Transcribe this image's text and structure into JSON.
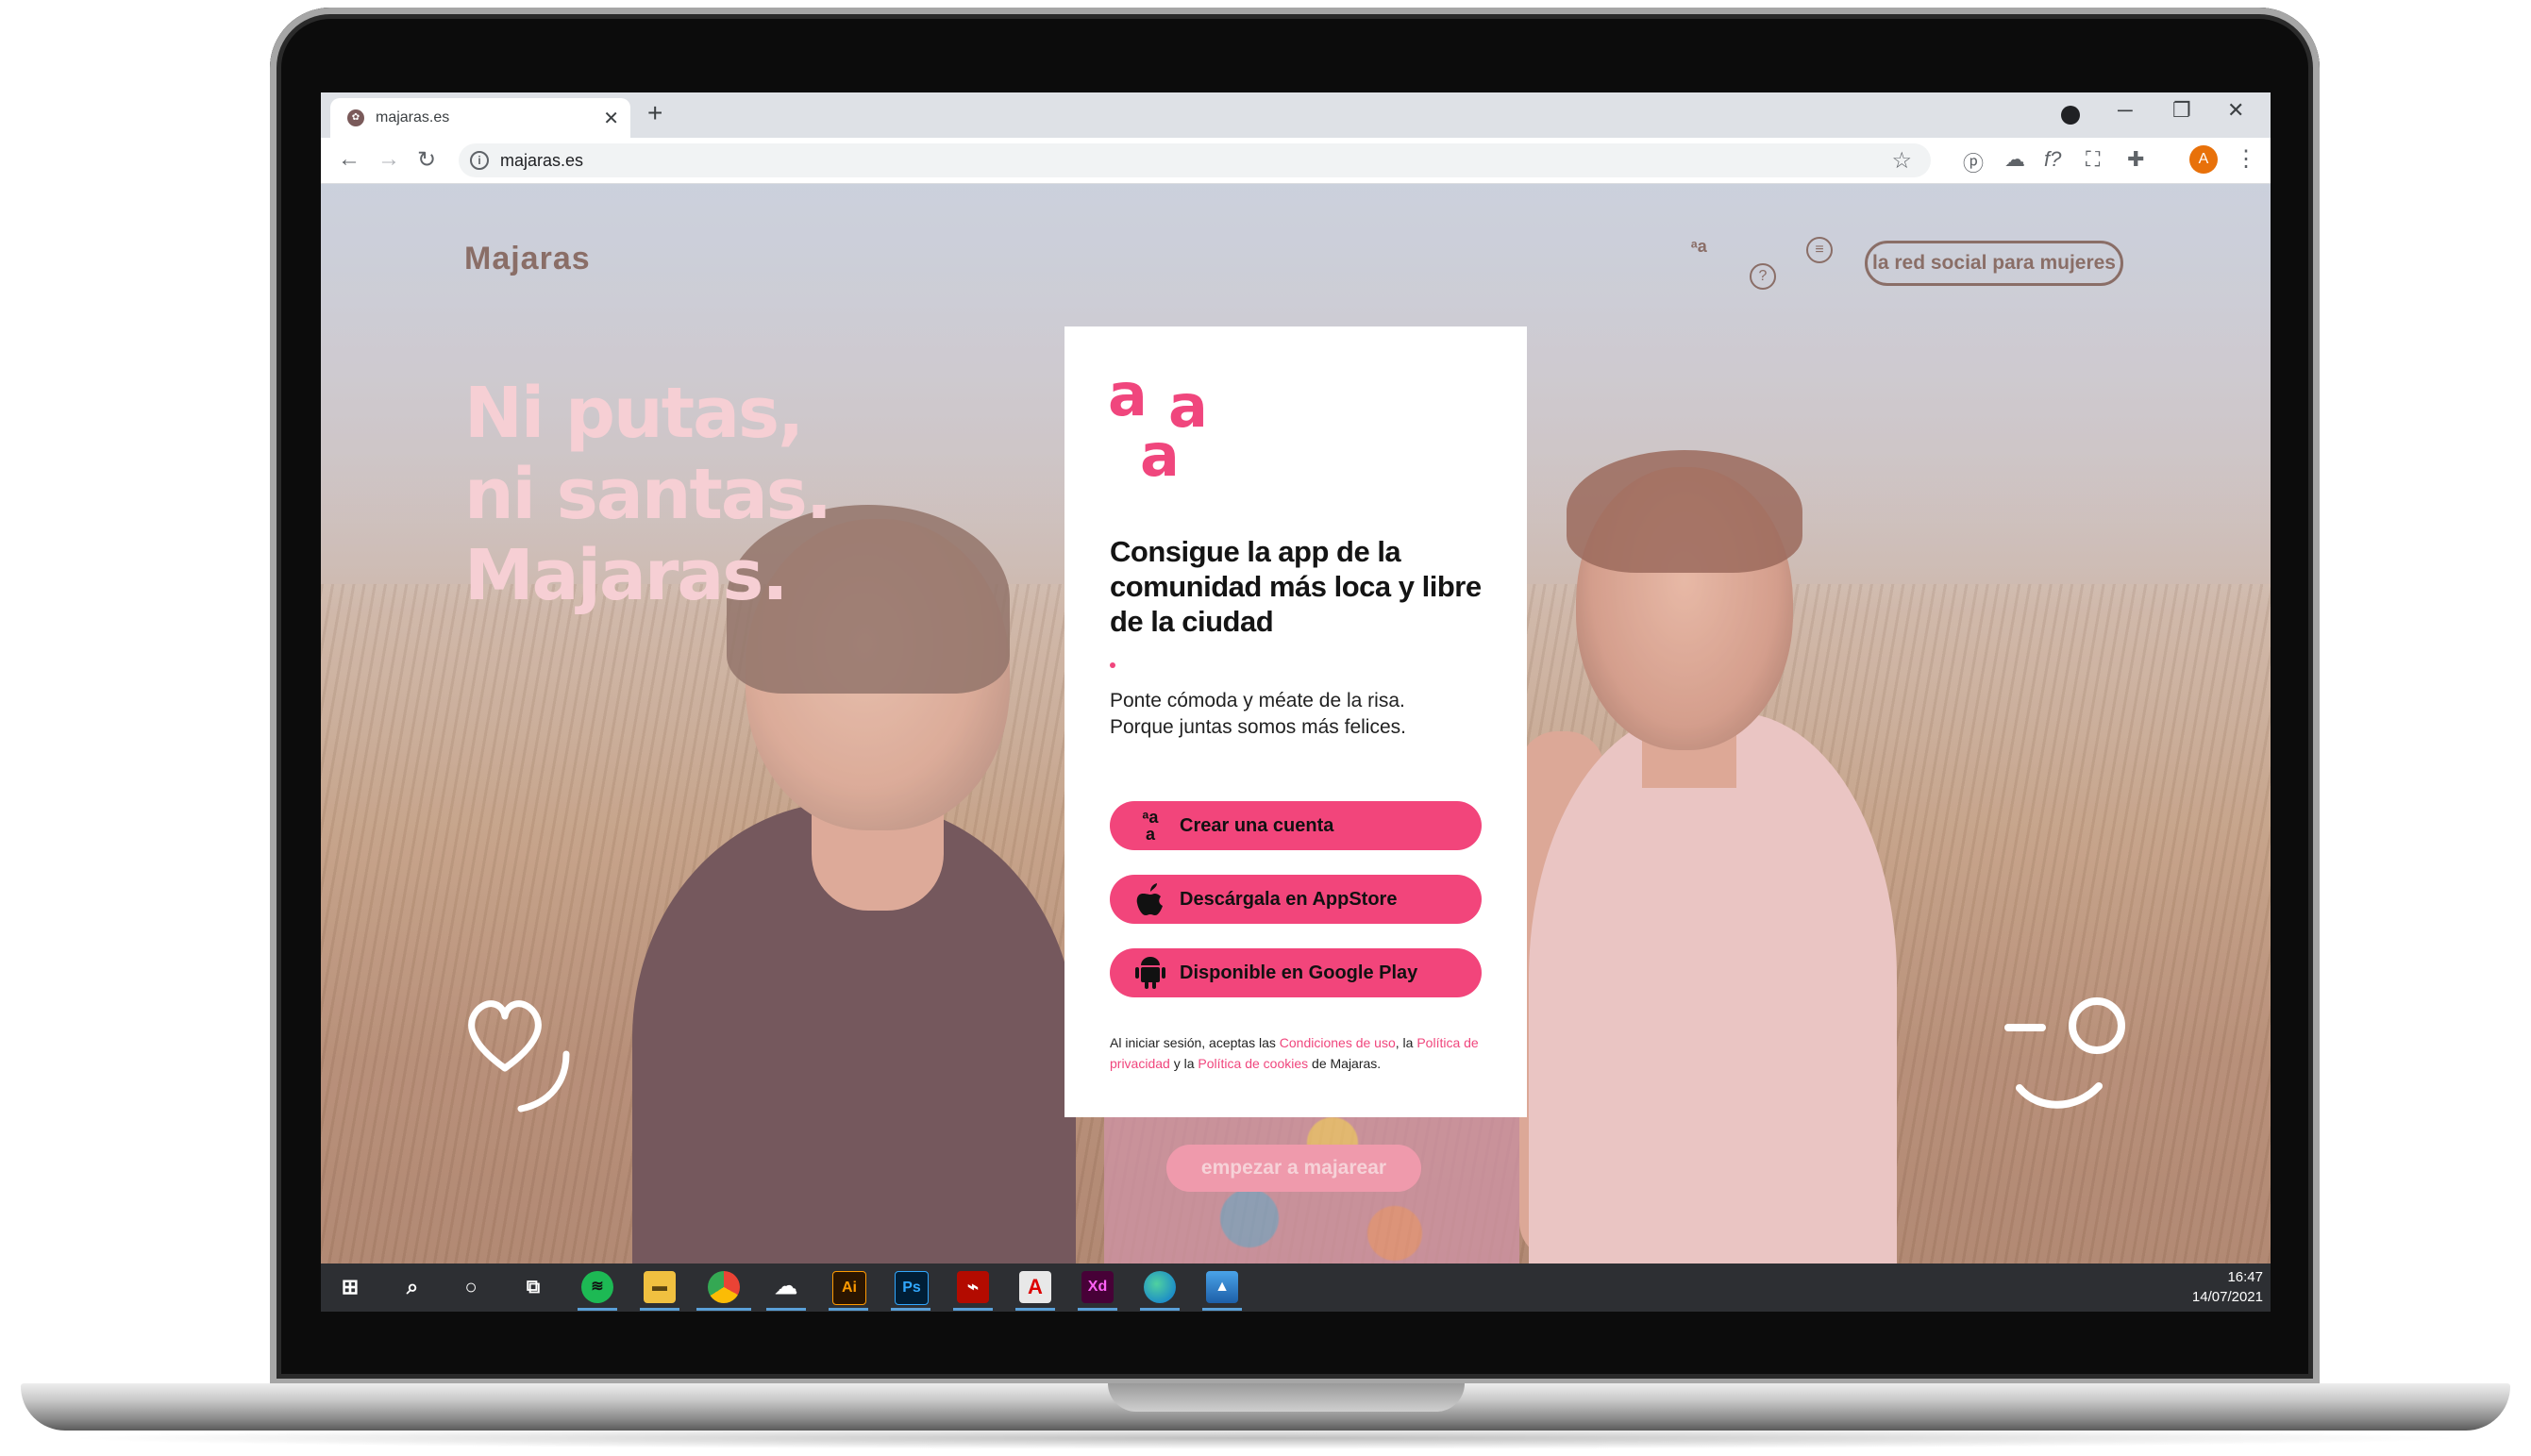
{
  "browser": {
    "tab_title": "majaras.es",
    "url": "majaras.es",
    "avatar_letter": "A"
  },
  "site": {
    "logo": "Majaras",
    "header_pill": "la red social para mujeres",
    "headline_lines": [
      "Ni putas,",
      "ni santas.",
      "Majaras."
    ],
    "start_button": "empezar a majarear"
  },
  "card": {
    "logo_letters": [
      "a",
      "a",
      "a"
    ],
    "heading": "Consigue la app de la comunidad  más loca y libre de la ciudad",
    "subtitle_line1": "Ponte cómoda y méate de la risa.",
    "subtitle_line2": "Porque juntas somos más felices.",
    "buttons": {
      "create": "Crear una cuenta",
      "appstore": "Descárgala en AppStore",
      "googleplay": "Disponible en Google Play"
    },
    "legal": {
      "prefix": "Al iniciar sesión, aceptas las",
      "terms": "Condiciones de uso",
      "sep1": ", la",
      "privacy": "Política de privacidad",
      "sep2": "y la",
      "cookies": "Política de cookies",
      "suffix": "de Majaras."
    }
  },
  "taskbar": {
    "time": "16:47",
    "date": "14/07/2021",
    "apps": [
      "Ai",
      "Ps",
      "A",
      "Xd"
    ]
  },
  "colors": {
    "brand_pink": "#f2457b",
    "headline_pink": "#f6cfd4",
    "muted_brown": "#8a6e67"
  }
}
